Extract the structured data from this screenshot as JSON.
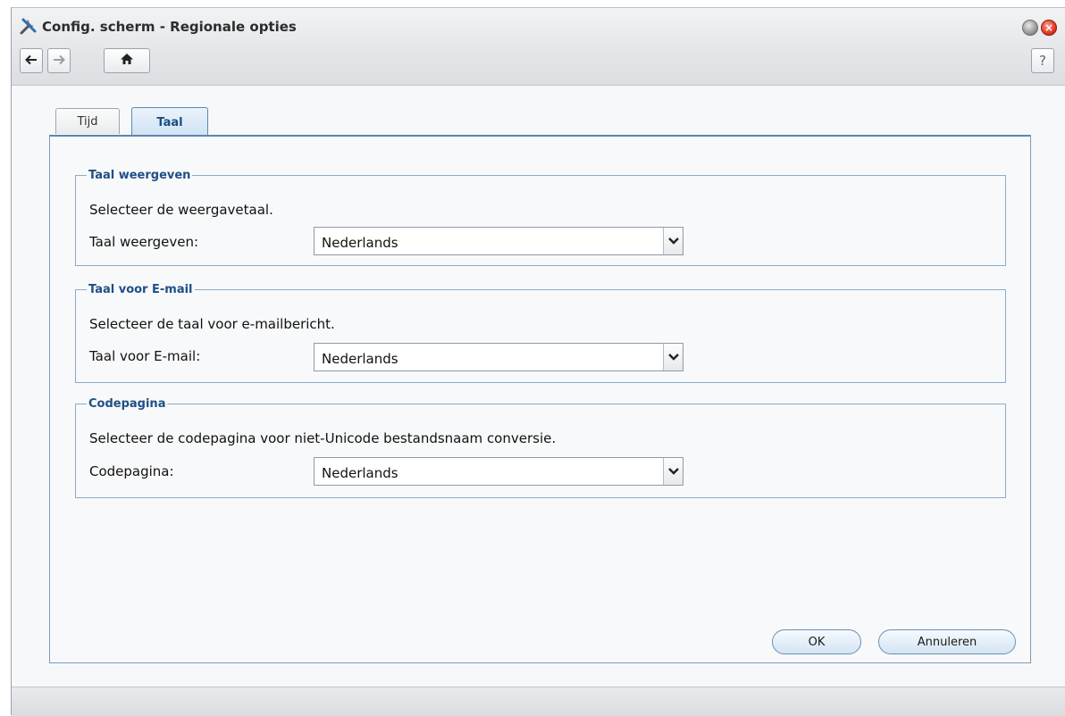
{
  "window": {
    "title": "Config. scherm - Regionale opties",
    "help_label": "?"
  },
  "tabs": [
    {
      "label": "Tijd",
      "active": false
    },
    {
      "label": "Taal",
      "active": true
    }
  ],
  "groups": [
    {
      "legend": "Taal weergeven",
      "description": "Selecteer de weergavetaal.",
      "field_label": "Taal weergeven:",
      "value": "Nederlands"
    },
    {
      "legend": "Taal voor E-mail",
      "description": "Selecteer de taal voor e-mailbericht.",
      "field_label": "Taal voor E-mail:",
      "value": "Nederlands"
    },
    {
      "legend": "Codepagina",
      "description": "Selecteer de codepagina voor niet-Unicode bestandsnaam conversie.",
      "field_label": "Codepagina:",
      "value": "Nederlands"
    }
  ],
  "buttons": {
    "ok": "OK",
    "cancel": "Annuleren"
  },
  "colors": {
    "accent": "#1f4f85",
    "close_button": "#e0321e"
  }
}
